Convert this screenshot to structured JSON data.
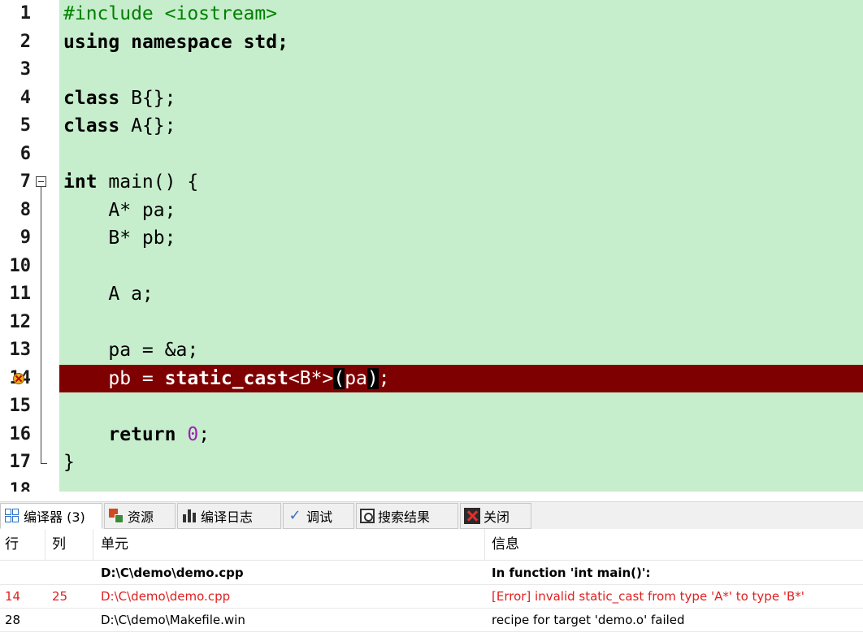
{
  "editor": {
    "lines": [
      {
        "num": "1",
        "code": "#include <iostream>"
      },
      {
        "num": "2",
        "code": "using namespace std;"
      },
      {
        "num": "3",
        "code": ""
      },
      {
        "num": "4",
        "code": "class B{};"
      },
      {
        "num": "5",
        "code": "class A{};"
      },
      {
        "num": "6",
        "code": ""
      },
      {
        "num": "7",
        "code": "int main() {"
      },
      {
        "num": "8",
        "code": "    A* pa;"
      },
      {
        "num": "9",
        "code": "    B* pb;"
      },
      {
        "num": "10",
        "code": ""
      },
      {
        "num": "11",
        "code": "    A a;"
      },
      {
        "num": "12",
        "code": ""
      },
      {
        "num": "13",
        "code": "    pa = &a;"
      },
      {
        "num": "14",
        "code": "    pb = static_cast<B*>(pa);"
      },
      {
        "num": "15",
        "code": ""
      },
      {
        "num": "16",
        "code": "    return 0;"
      },
      {
        "num": "17",
        "code": "}"
      },
      {
        "num": "18",
        "code": ""
      }
    ],
    "error_line": "14",
    "colors": {
      "background": "#c6edcc",
      "error_line": "#7f0000",
      "preprocessor": "#008000",
      "number": "#9c1fb5"
    }
  },
  "tabs": [
    {
      "label": "编译器 (3)",
      "icon": "compiler-grid-icon",
      "active": true
    },
    {
      "label": "资源",
      "icon": "resources-icon"
    },
    {
      "label": "编译日志",
      "icon": "compile-log-chart-icon"
    },
    {
      "label": "调试",
      "icon": "debug-check-icon"
    },
    {
      "label": "搜索结果",
      "icon": "search-results-icon"
    },
    {
      "label": "关闭",
      "icon": "close-icon"
    }
  ],
  "messages": {
    "headers": {
      "line": "行",
      "col": "列",
      "unit": "单元",
      "message": "信息"
    },
    "rows": [
      {
        "line": "",
        "col": "",
        "unit": "D:\\C\\demo\\demo.cpp",
        "message": "In function 'int main()':"
      },
      {
        "line": "14",
        "col": "25",
        "unit": "D:\\C\\demo\\demo.cpp",
        "message": "[Error] invalid static_cast from type 'A*' to type 'B*'"
      },
      {
        "line": "28",
        "col": "",
        "unit": "D:\\C\\demo\\Makefile.win",
        "message": "recipe for target 'demo.o' failed"
      }
    ],
    "colors": {
      "error_text": "#e02020"
    }
  }
}
